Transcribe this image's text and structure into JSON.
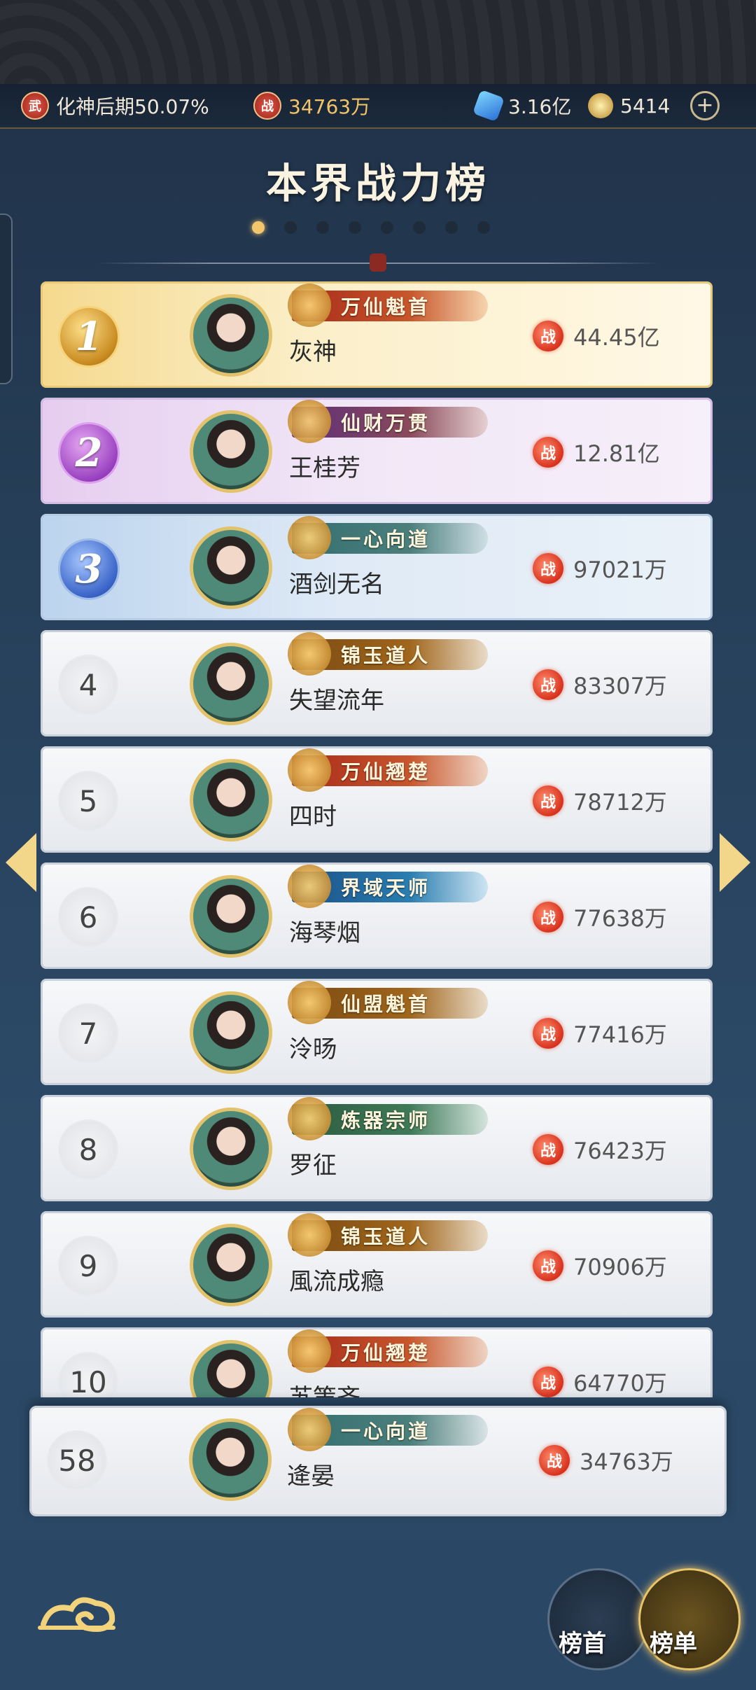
{
  "resources": {
    "realm": "化神后期50.07%",
    "realm_icon": "wu-badge-icon",
    "realm_icon_text": "武",
    "power": "34763万",
    "power_icon_text": "战",
    "spirit_stones": "3.16亿",
    "jade": "5414",
    "add_label": "+"
  },
  "title": "本界战力榜",
  "pager": {
    "total": 8,
    "active": 0
  },
  "rows": [
    {
      "rank": "1",
      "name": "灰神",
      "title": "万仙魁首",
      "power": "44.45亿",
      "medal": "m1",
      "banner": "b-red"
    },
    {
      "rank": "2",
      "name": "王桂芳",
      "title": "仙财万贯",
      "power": "12.81亿",
      "medal": "m2",
      "banner": "b-purple"
    },
    {
      "rank": "3",
      "name": "酒剑无名",
      "title": "一心向道",
      "power": "97021万",
      "medal": "m3",
      "banner": "b-teal"
    },
    {
      "rank": "4",
      "name": "失望流年",
      "title": "锦玉道人",
      "power": "83307万",
      "banner": "b-gold"
    },
    {
      "rank": "5",
      "name": "四时",
      "title": "万仙翘楚",
      "power": "78712万",
      "banner": "b-red"
    },
    {
      "rank": "6",
      "name": "海琴烟",
      "title": "界域天师",
      "power": "77638万",
      "banner": "b-blue"
    },
    {
      "rank": "7",
      "name": "泠旸",
      "title": "仙盟魁首",
      "power": "77416万",
      "banner": "b-gold"
    },
    {
      "rank": "8",
      "name": "罗征",
      "title": "炼器宗师",
      "power": "76423万",
      "banner": "b-green"
    },
    {
      "rank": "9",
      "name": "風流成瘾",
      "title": "锦玉道人",
      "power": "70906万",
      "banner": "b-gold"
    },
    {
      "rank": "10",
      "name": "苏策齐",
      "title": "万仙翘楚",
      "power": "64770万",
      "banner": "b-red"
    }
  ],
  "self": {
    "rank": "58",
    "name": "逄晏",
    "title": "一心向道",
    "power": "34763万"
  },
  "power_badge": "战",
  "buttons": {
    "first": "榜首",
    "list": "榜单"
  },
  "colors": {
    "accent_gold": "#f2c66c",
    "power_red": "#d8321e"
  }
}
